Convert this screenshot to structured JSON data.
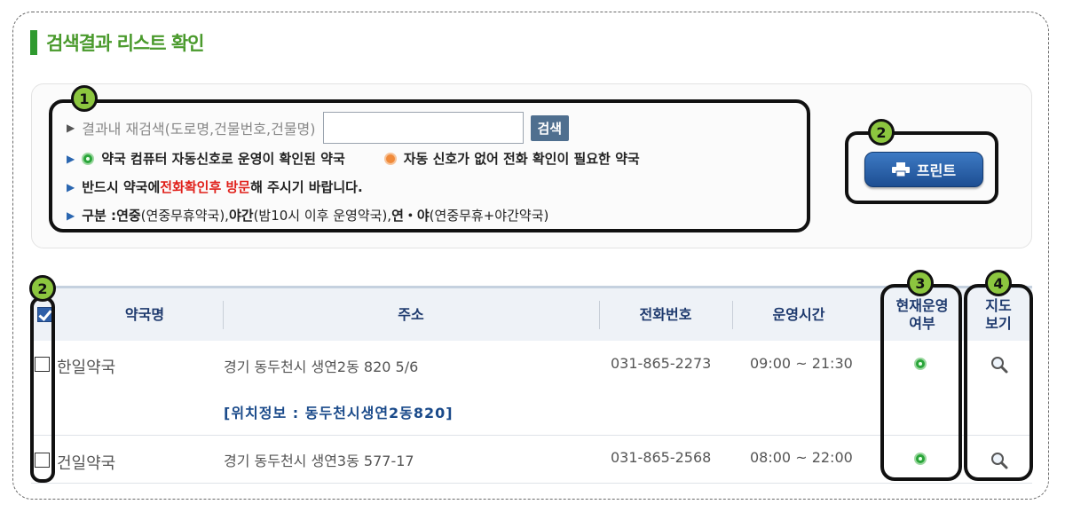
{
  "page_title": "검색결과 리스트 확인",
  "badges": [
    "1",
    "2",
    "2",
    "3",
    "4"
  ],
  "search": {
    "label": "결과내 재검색(도로명,건물번호,건물명)",
    "input_value": "",
    "button_label": "검색"
  },
  "legend": {
    "green_label": "약국 컴퓨터 자동신호로 운영이 확인된 약국",
    "orange_label": "자동 신호가 없어 전화 확인이 필요한 약국"
  },
  "notice": {
    "prefix": "반드시 약국에 ",
    "highlight": "전화확인후 방문",
    "suffix": "해 주시기 바랍니다."
  },
  "category": {
    "label": "구분 : ",
    "t1_bold": "연중",
    "t1_norm": "(연중무휴약국), ",
    "t2_bold": "야간",
    "t2_norm": "(밤10시 이후 운영약국), ",
    "t3_bold": "연・야",
    "t3_norm": "(연중무휴+야간약국)"
  },
  "print_label": "프린트",
  "table": {
    "headers": {
      "name": "약국명",
      "address": "주소",
      "phone": "전화번호",
      "hours": "운영시간",
      "status_line1": "현재운영",
      "status_line2": "여부",
      "map_line1": "지도",
      "map_line2": "보기"
    },
    "select_all_checked": true,
    "rows": [
      {
        "checked": false,
        "name": "한일약국",
        "address": "경기 동두천시 생연2동 820 5/6",
        "phone": "031-865-2273",
        "hours": "09:00 ~ 21:30",
        "location": "[위치정보 : 동두천시생연2동820]",
        "status": "green"
      },
      {
        "checked": false,
        "name": "건일약국",
        "address": "경기 동두천시 생연3동 577-17",
        "phone": "031-865-2568",
        "hours": "08:00 ~ 22:00",
        "status": "green"
      }
    ]
  },
  "colors": {
    "title_green": "#4a9a2c",
    "header_text": "#1e3a6e",
    "alert_red": "#e0201a",
    "badge_green": "#8cc63f"
  },
  "icons": {
    "printer": "printer-icon",
    "status": "green-status-icon",
    "map": "magnifier-icon"
  }
}
